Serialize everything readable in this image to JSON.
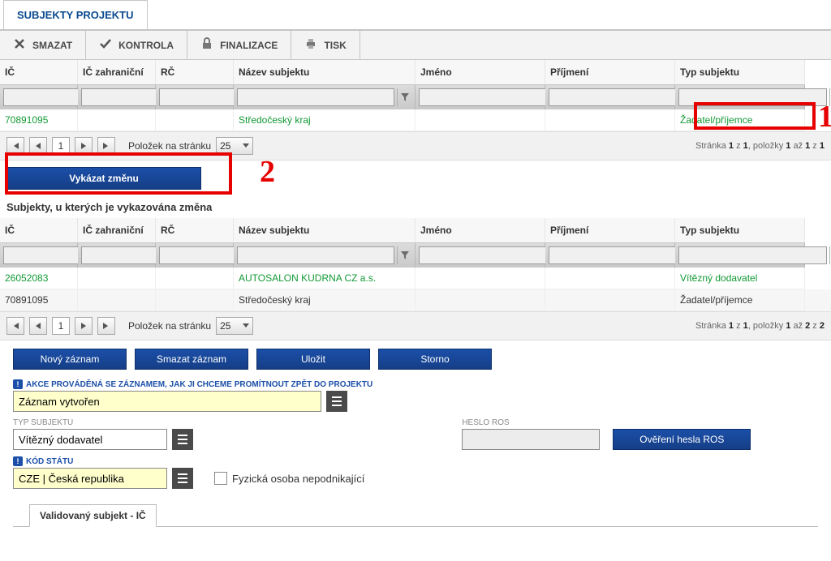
{
  "page_tab": "SUBJEKTY PROJEKTU",
  "toolbar": {
    "delete": "SMAZAT",
    "check": "KONTROLA",
    "finalize": "FINALIZACE",
    "print": "TISK"
  },
  "grid_headers": {
    "ic": "IČ",
    "ic_zahr": "IČ zahraniční",
    "rc": "RČ",
    "nazev": "Název subjektu",
    "jmeno": "Jméno",
    "prijmeni": "Příjmení",
    "typ": "Typ subjektu"
  },
  "grid1_rows": [
    {
      "ic": "70891095",
      "nazev": "Středočeský kraj",
      "typ": "Žadatel/příjemce"
    }
  ],
  "pager": {
    "page": "1",
    "perpage_label": "Položek na stránku",
    "perpage": "25",
    "info_prefix": "Stránka",
    "info1": "Stránka 1 z 1, položky 1 až 1 z 1",
    "info2": "Stránka 1 z 1, položky 1 až 2 z 2"
  },
  "btn_vykazat": "Vykázat změnu",
  "section2_title": "Subjekty, u kterých je vykazována změna",
  "grid2_rows": [
    {
      "ic": "26052083",
      "nazev": "AUTOSALON KUDRNA CZ a.s.",
      "typ": "Vítězný dodavatel",
      "green": true
    },
    {
      "ic": "70891095",
      "nazev": "Středočeský kraj",
      "typ": "Žadatel/příjemce",
      "green": false
    }
  ],
  "actions": {
    "new": "Nový záznam",
    "del": "Smazat záznam",
    "save": "Uložit",
    "cancel": "Storno"
  },
  "form": {
    "akce_label": "AKCE PROVÁDĚNÁ SE ZÁZNAMEM, JAK JI CHCEME PROMÍTNOUT ZPĚT DO PROJEKTU",
    "akce_value": "Záznam vytvořen",
    "typ_label": "TYP SUBJEKTU",
    "typ_value": "Vítězný dodavatel",
    "heslo_label": "HESLO ROS",
    "heslo_value": "",
    "overeni_btn": "Ověření hesla ROS",
    "kod_label": "KÓD STÁTU",
    "kod_value": "CZE | Česká republika",
    "fyz_label": "Fyzická osoba nepodnikající"
  },
  "subtab": "Validovaný subjekt - IČ",
  "annotations": {
    "num1": "1",
    "num2": "2"
  }
}
